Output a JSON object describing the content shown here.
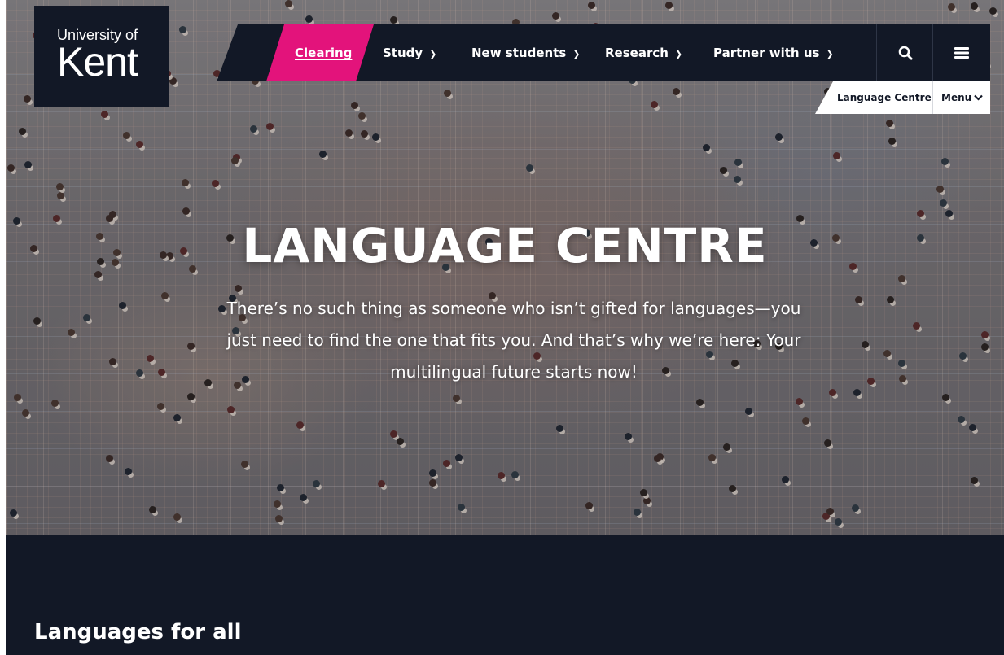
{
  "brand": {
    "logo_top": "University of",
    "logo_main": "Kent",
    "colors": {
      "navy": "#121826",
      "magenta": "#e3137b",
      "white": "#ffffff"
    }
  },
  "nav": {
    "items": [
      {
        "label": "Clearing"
      },
      {
        "label": "Study"
      },
      {
        "label": "New students"
      },
      {
        "label": "Research"
      },
      {
        "label": "Partner with us"
      }
    ],
    "search_icon": "search-icon",
    "menu_icon": "hamburger-menu-icon"
  },
  "subnav": {
    "section": "Language Centre",
    "menu_label": "Menu"
  },
  "hero": {
    "title": "LANGUAGE CENTRE",
    "text": "There’s no such thing as someone who isn’t gifted for languages—you just need to find the one that fits you. And that’s why we’re here: Your multilingual future starts now!"
  },
  "section": {
    "title": "Languages for all"
  }
}
